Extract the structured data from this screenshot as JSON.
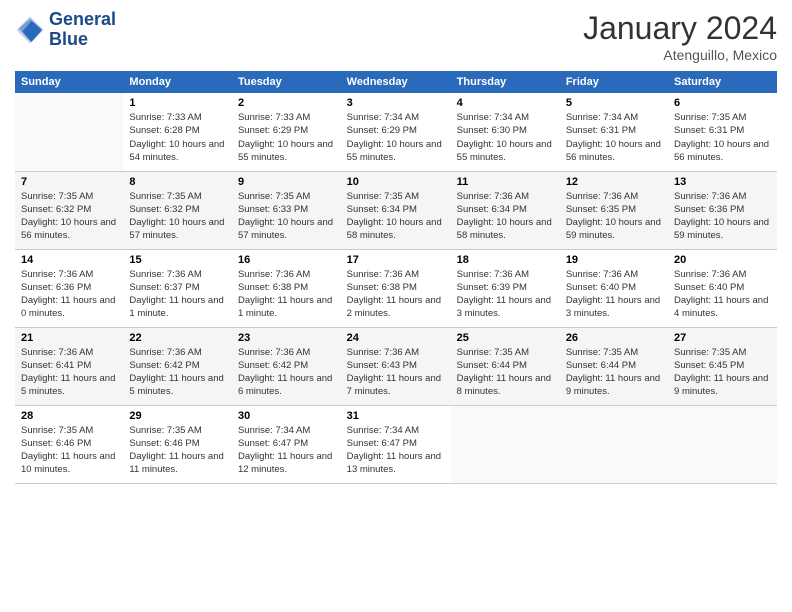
{
  "header": {
    "logo_line1": "General",
    "logo_line2": "Blue",
    "title": "January 2024",
    "location": "Atenguillo, Mexico"
  },
  "days_of_week": [
    "Sunday",
    "Monday",
    "Tuesday",
    "Wednesday",
    "Thursday",
    "Friday",
    "Saturday"
  ],
  "weeks": [
    [
      {
        "day": "",
        "sunrise": "",
        "sunset": "",
        "daylight": ""
      },
      {
        "day": "1",
        "sunrise": "Sunrise: 7:33 AM",
        "sunset": "Sunset: 6:28 PM",
        "daylight": "Daylight: 10 hours and 54 minutes."
      },
      {
        "day": "2",
        "sunrise": "Sunrise: 7:33 AM",
        "sunset": "Sunset: 6:29 PM",
        "daylight": "Daylight: 10 hours and 55 minutes."
      },
      {
        "day": "3",
        "sunrise": "Sunrise: 7:34 AM",
        "sunset": "Sunset: 6:29 PM",
        "daylight": "Daylight: 10 hours and 55 minutes."
      },
      {
        "day": "4",
        "sunrise": "Sunrise: 7:34 AM",
        "sunset": "Sunset: 6:30 PM",
        "daylight": "Daylight: 10 hours and 55 minutes."
      },
      {
        "day": "5",
        "sunrise": "Sunrise: 7:34 AM",
        "sunset": "Sunset: 6:31 PM",
        "daylight": "Daylight: 10 hours and 56 minutes."
      },
      {
        "day": "6",
        "sunrise": "Sunrise: 7:35 AM",
        "sunset": "Sunset: 6:31 PM",
        "daylight": "Daylight: 10 hours and 56 minutes."
      }
    ],
    [
      {
        "day": "7",
        "sunrise": "Sunrise: 7:35 AM",
        "sunset": "Sunset: 6:32 PM",
        "daylight": "Daylight: 10 hours and 56 minutes."
      },
      {
        "day": "8",
        "sunrise": "Sunrise: 7:35 AM",
        "sunset": "Sunset: 6:32 PM",
        "daylight": "Daylight: 10 hours and 57 minutes."
      },
      {
        "day": "9",
        "sunrise": "Sunrise: 7:35 AM",
        "sunset": "Sunset: 6:33 PM",
        "daylight": "Daylight: 10 hours and 57 minutes."
      },
      {
        "day": "10",
        "sunrise": "Sunrise: 7:35 AM",
        "sunset": "Sunset: 6:34 PM",
        "daylight": "Daylight: 10 hours and 58 minutes."
      },
      {
        "day": "11",
        "sunrise": "Sunrise: 7:36 AM",
        "sunset": "Sunset: 6:34 PM",
        "daylight": "Daylight: 10 hours and 58 minutes."
      },
      {
        "day": "12",
        "sunrise": "Sunrise: 7:36 AM",
        "sunset": "Sunset: 6:35 PM",
        "daylight": "Daylight: 10 hours and 59 minutes."
      },
      {
        "day": "13",
        "sunrise": "Sunrise: 7:36 AM",
        "sunset": "Sunset: 6:36 PM",
        "daylight": "Daylight: 10 hours and 59 minutes."
      }
    ],
    [
      {
        "day": "14",
        "sunrise": "Sunrise: 7:36 AM",
        "sunset": "Sunset: 6:36 PM",
        "daylight": "Daylight: 11 hours and 0 minutes."
      },
      {
        "day": "15",
        "sunrise": "Sunrise: 7:36 AM",
        "sunset": "Sunset: 6:37 PM",
        "daylight": "Daylight: 11 hours and 1 minute."
      },
      {
        "day": "16",
        "sunrise": "Sunrise: 7:36 AM",
        "sunset": "Sunset: 6:38 PM",
        "daylight": "Daylight: 11 hours and 1 minute."
      },
      {
        "day": "17",
        "sunrise": "Sunrise: 7:36 AM",
        "sunset": "Sunset: 6:38 PM",
        "daylight": "Daylight: 11 hours and 2 minutes."
      },
      {
        "day": "18",
        "sunrise": "Sunrise: 7:36 AM",
        "sunset": "Sunset: 6:39 PM",
        "daylight": "Daylight: 11 hours and 3 minutes."
      },
      {
        "day": "19",
        "sunrise": "Sunrise: 7:36 AM",
        "sunset": "Sunset: 6:40 PM",
        "daylight": "Daylight: 11 hours and 3 minutes."
      },
      {
        "day": "20",
        "sunrise": "Sunrise: 7:36 AM",
        "sunset": "Sunset: 6:40 PM",
        "daylight": "Daylight: 11 hours and 4 minutes."
      }
    ],
    [
      {
        "day": "21",
        "sunrise": "Sunrise: 7:36 AM",
        "sunset": "Sunset: 6:41 PM",
        "daylight": "Daylight: 11 hours and 5 minutes."
      },
      {
        "day": "22",
        "sunrise": "Sunrise: 7:36 AM",
        "sunset": "Sunset: 6:42 PM",
        "daylight": "Daylight: 11 hours and 5 minutes."
      },
      {
        "day": "23",
        "sunrise": "Sunrise: 7:36 AM",
        "sunset": "Sunset: 6:42 PM",
        "daylight": "Daylight: 11 hours and 6 minutes."
      },
      {
        "day": "24",
        "sunrise": "Sunrise: 7:36 AM",
        "sunset": "Sunset: 6:43 PM",
        "daylight": "Daylight: 11 hours and 7 minutes."
      },
      {
        "day": "25",
        "sunrise": "Sunrise: 7:35 AM",
        "sunset": "Sunset: 6:44 PM",
        "daylight": "Daylight: 11 hours and 8 minutes."
      },
      {
        "day": "26",
        "sunrise": "Sunrise: 7:35 AM",
        "sunset": "Sunset: 6:44 PM",
        "daylight": "Daylight: 11 hours and 9 minutes."
      },
      {
        "day": "27",
        "sunrise": "Sunrise: 7:35 AM",
        "sunset": "Sunset: 6:45 PM",
        "daylight": "Daylight: 11 hours and 9 minutes."
      }
    ],
    [
      {
        "day": "28",
        "sunrise": "Sunrise: 7:35 AM",
        "sunset": "Sunset: 6:46 PM",
        "daylight": "Daylight: 11 hours and 10 minutes."
      },
      {
        "day": "29",
        "sunrise": "Sunrise: 7:35 AM",
        "sunset": "Sunset: 6:46 PM",
        "daylight": "Daylight: 11 hours and 11 minutes."
      },
      {
        "day": "30",
        "sunrise": "Sunrise: 7:34 AM",
        "sunset": "Sunset: 6:47 PM",
        "daylight": "Daylight: 11 hours and 12 minutes."
      },
      {
        "day": "31",
        "sunrise": "Sunrise: 7:34 AM",
        "sunset": "Sunset: 6:47 PM",
        "daylight": "Daylight: 11 hours and 13 minutes."
      },
      {
        "day": "",
        "sunrise": "",
        "sunset": "",
        "daylight": ""
      },
      {
        "day": "",
        "sunrise": "",
        "sunset": "",
        "daylight": ""
      },
      {
        "day": "",
        "sunrise": "",
        "sunset": "",
        "daylight": ""
      }
    ]
  ]
}
